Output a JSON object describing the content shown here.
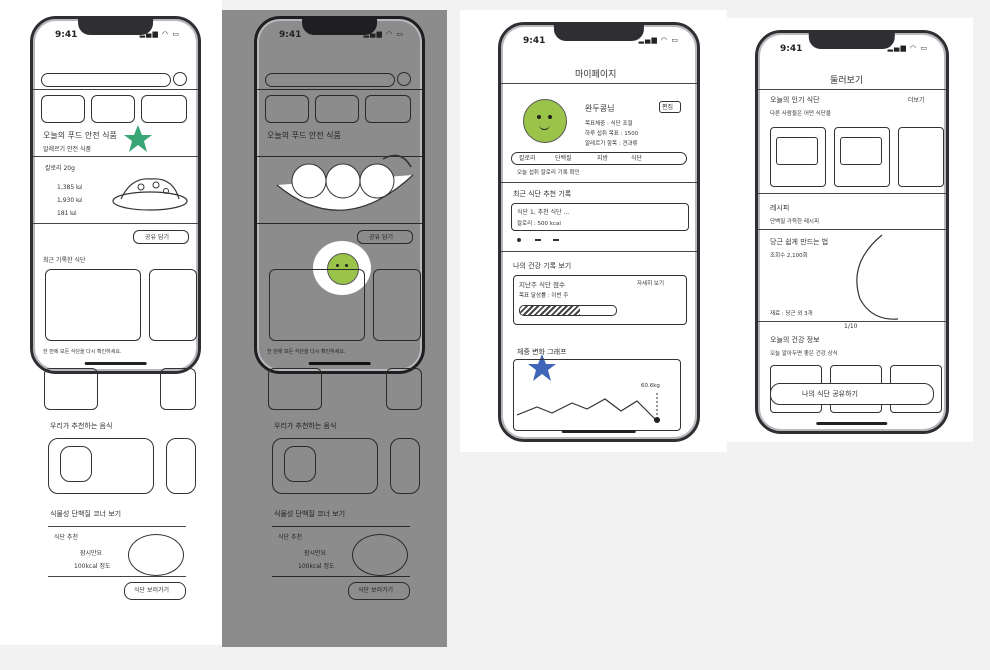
{
  "colors": {
    "background": "#f2f2f2",
    "dim_panel": "#8c8c8c",
    "pea_green": "#9ac34a",
    "star_green": "#3aa676",
    "star_blue": "#3f66b8"
  },
  "status_bar": {
    "time": "9:41"
  },
  "screen1": {
    "section_title": "오늘의 푸드 안전 식품",
    "section_sub": "알레르기 안전 식품",
    "card_text": "칼로리 20g",
    "stats": [
      "1,385 ㎉",
      "1,930 ㎉",
      "181 ㎉"
    ],
    "rec_button": "공유 담기",
    "recent_label": "최근 기록한 식단",
    "bottom_note": "한 번에 모든 식단을 다시 확인하세요.",
    "lower_section1": "우리가 추천하는 음식",
    "lower_section2": "식물성 단백질 코너 보기",
    "lower_text1": "식단 추천",
    "lower_text2": "잠시만요",
    "lower_text3": "100kcal 정도",
    "lower_button": "식단 보러가기"
  },
  "screen2": {
    "section_title": "오늘의 푸드 안전 식품",
    "rec_button": "공유 담기",
    "bottom_note": "한 번에 모든 식단을 다시 확인하세요."
  },
  "screen3": {
    "title": "마이페이지",
    "profile_name": "완두콩님",
    "edit": "편집",
    "info_line1": "목표체중 : 식단 조절",
    "info_line2": "하루 섭취 목표 : 1500",
    "info_line3": "알레르기 항목 : 견과류",
    "tags": [
      "칼로리",
      "단백질",
      "지방",
      "식단"
    ],
    "tag_sub": "오늘 섭취 칼로리 기록 확인",
    "section1": "최근 식단 추천 기록",
    "section1_item": "식단 1, 추천 식단 ...",
    "section1_sub": "칼로리 : 500 kcal",
    "section2": "나의 건강 기록 보기",
    "section2_item": "지난주 식단 점수",
    "section2_link": "자세히 보기",
    "section2_sub": "목표 달성률 : 이번 주",
    "section3": "체중 변화 그래프",
    "chart_value": "60.6kg"
  },
  "screen4": {
    "title": "둘러보기",
    "section1": "오늘의 인기 식단",
    "section1_link": "더보기",
    "section1_sub": "다른 사람들은 어떤 식단을",
    "section2": "레시피",
    "section2_sub": "단백질 가득한 레시피",
    "section3": "당근 쉽게 만드는 법",
    "section3_sub": "조회수 2,100회",
    "section3_note": "재료 : 당근 외 3개",
    "page": "1/10",
    "section4": "오늘의 건강 정보",
    "section4_sub": "오늘 알아두면 좋은 건강 상식",
    "bottom_button": "나의 식단 공유하기"
  }
}
